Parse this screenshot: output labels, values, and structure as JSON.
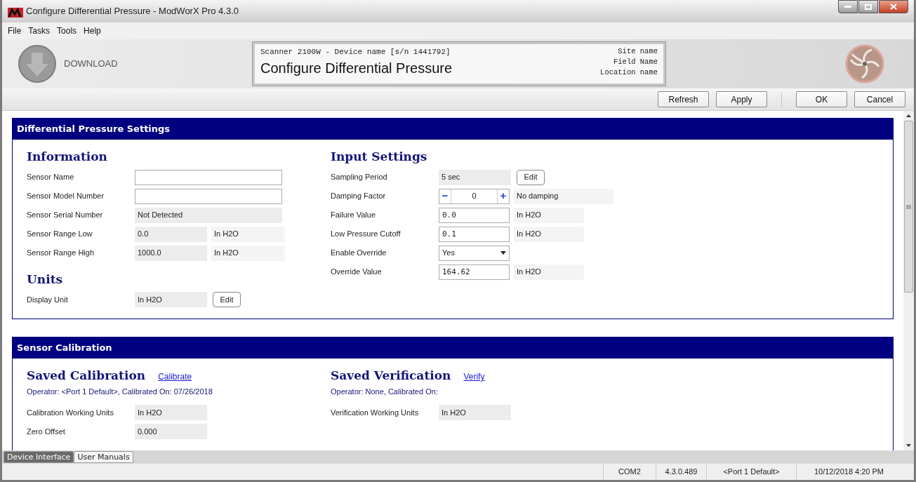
{
  "window": {
    "title": "Configure Differential Pressure - ModWorX Pro 4.3.0"
  },
  "menu": [
    "File",
    "Tasks",
    "Tools",
    "Help"
  ],
  "header": {
    "download_button": {
      "label": "DOWNLOAD"
    },
    "device_box": {
      "device": "Scanner 2100W - Device name [s/n 1441792]",
      "title": "Configure Differential Pressure",
      "site": "Site name",
      "field": "Field Name",
      "location": "Location name"
    }
  },
  "toolbar": [
    [
      "Refresh",
      "Apply"
    ],
    [
      "OK",
      "Cancel"
    ]
  ],
  "sections": [
    {
      "title": "Differential Pressure Settings",
      "columns": [
        {
          "groups": [
            {
              "heading": "Information",
              "rows": [
                {
                  "label": "Sensor Name",
                  "kind": "input"
                },
                {
                  "label": "Sensor Model Number",
                  "kind": "input"
                },
                {
                  "label": "Sensor Serial Number",
                  "kind": "readonly_wide",
                  "value": "Not Detected"
                },
                {
                  "label": "Sensor Range Low",
                  "kind": "readonly",
                  "value": "0.0",
                  "unit": "In H2O"
                },
                {
                  "label": "Sensor Range High",
                  "kind": "readonly",
                  "value": "1000.0",
                  "unit": "In H2O"
                }
              ]
            },
            {
              "heading": "Units",
              "rows": [
                {
                  "label": "Display Unit",
                  "kind": "readonly",
                  "value": "In H2O",
                  "button": "Edit"
                }
              ]
            }
          ]
        },
        {
          "groups": [
            {
              "heading": "Input Settings",
              "rows": [
                {
                  "label": "Sampling Period",
                  "kind": "readonly",
                  "value": "5 sec",
                  "button": "Edit"
                },
                {
                  "label": "Damping Factor",
                  "kind": "stepper",
                  "value": "0",
                  "minus": "−",
                  "plus": "+",
                  "unit": "No damping"
                },
                {
                  "label": "Failure Value",
                  "kind": "input",
                  "value": "0.0",
                  "unit": "In H2O"
                },
                {
                  "label": "Low Pressure Cutoff",
                  "kind": "input",
                  "value": "0.1",
                  "unit": "In H2O"
                },
                {
                  "label": "Enable Override",
                  "kind": "select",
                  "value": "Yes"
                },
                {
                  "label": "Override Value",
                  "kind": "input",
                  "value": "164.62",
                  "unit": "In H2O"
                }
              ]
            }
          ]
        }
      ]
    },
    {
      "title": "Sensor Calibration",
      "columns": [
        {
          "groups": [
            {
              "heading": "Saved Calibration",
              "link": "Calibrate",
              "subtitle": "Operator: <Port 1 Default>, Calibrated On: 07/26/2018",
              "rows": [
                {
                  "label": "Calibration Working Units",
                  "kind": "readonly",
                  "value": "In H2O"
                },
                {
                  "label": "Zero Offset",
                  "kind": "readonly",
                  "value": "0.000"
                }
              ]
            }
          ]
        },
        {
          "groups": [
            {
              "heading": "Saved Verification",
              "link": "Verify",
              "subtitle": "Operator: None, Calibrated On:",
              "rows": [
                {
                  "label": "Verification Working Units",
                  "kind": "readonly",
                  "value": "In H2O"
                }
              ]
            }
          ]
        }
      ]
    }
  ],
  "bottom_tabs": [
    {
      "label": "Device Interface",
      "selected": true
    },
    {
      "label": "User Manuals",
      "selected": false
    }
  ],
  "status_bar": [
    "COM2",
    "4.3.0.489",
    "<Port 1 Default>",
    "10/12/2018 4:20 PM"
  ]
}
